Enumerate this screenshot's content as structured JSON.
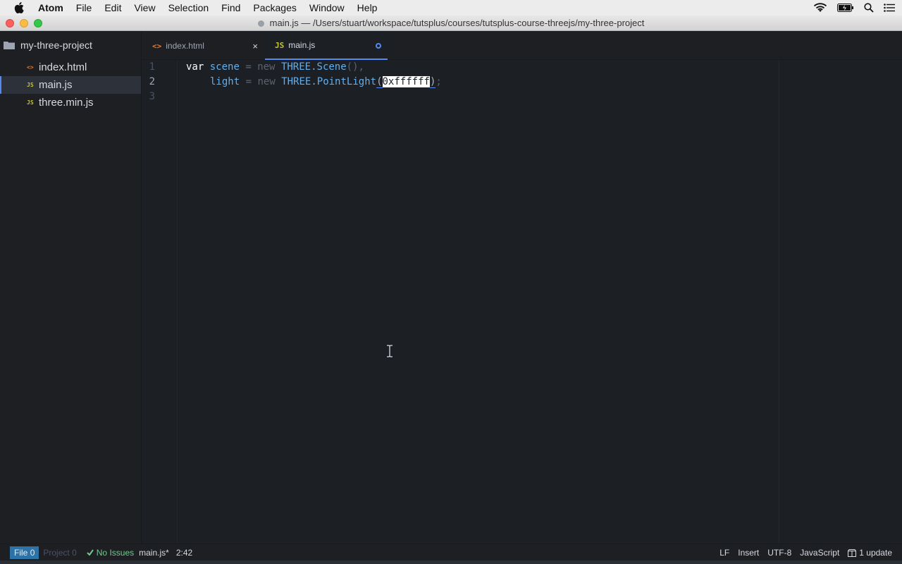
{
  "menubar": {
    "app_name": "Atom",
    "items": [
      "File",
      "Edit",
      "View",
      "Selection",
      "Find",
      "Packages",
      "Window",
      "Help"
    ],
    "status_icons": [
      "wifi-icon",
      "battery-icon",
      "spotlight-icon",
      "notification-center-icon"
    ]
  },
  "window": {
    "title": "main.js — /Users/stuart/workspace/tutsplus/courses/tutsplus-course-threejs/my-three-project"
  },
  "tree_view": {
    "project_name": "my-three-project",
    "files": [
      {
        "name": "index.html",
        "icon": "html-icon",
        "selected": false
      },
      {
        "name": "main.js",
        "icon": "js-icon",
        "selected": true
      },
      {
        "name": "three.min.js",
        "icon": "js-icon",
        "selected": false
      }
    ]
  },
  "tabs": [
    {
      "label": "index.html",
      "icon_label": "<>",
      "active": false,
      "close": "×"
    },
    {
      "label": "main.js",
      "icon_label": "JS",
      "active": true,
      "modified": true
    }
  ],
  "editor": {
    "line_numbers": [
      "1",
      "2",
      "3"
    ],
    "current_line": 2,
    "code": {
      "l1_kw": "var",
      "l1_var": "scene",
      "l1_op": "=",
      "l1_new": "new",
      "l1_cls": "THREE.Scene",
      "l1_punc": "(),",
      "l2_var": "light",
      "l2_op": "=",
      "l2_new": "new",
      "l2_cls": "THREE.PointLight",
      "l2_open": "(",
      "l2_selected": "0xffffff",
      "l2_close": ")",
      "l2_semi": ";"
    }
  },
  "status_bar": {
    "file_label": "File",
    "file_count": "0",
    "project_label": "Project",
    "project_count": "0",
    "issues": "No Issues",
    "filename": "main.js*",
    "cursor_position": "2:42",
    "line_ending": "LF",
    "mode": "Insert",
    "encoding": "UTF-8",
    "grammar": "JavaScript",
    "updates": "1 update"
  }
}
